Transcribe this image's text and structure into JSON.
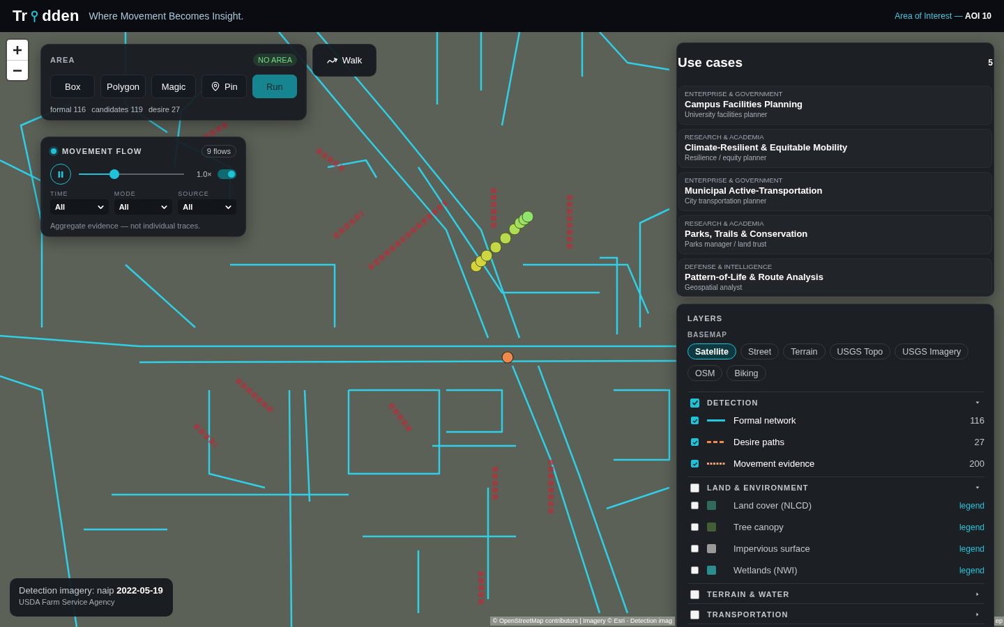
{
  "header": {
    "logo_left": "Tr",
    "logo_right": "dden",
    "tagline": "Where Movement Becomes Insight.",
    "area_of_interest": "Area of Interest — **AOI 10**"
  },
  "area_panel": {
    "title": "AREA",
    "status": "NO AREA",
    "tools": [
      {
        "label": "Box",
        "kind": "mode"
      },
      {
        "label": "Polygon",
        "kind": "mode"
      },
      {
        "label": "Magic",
        "kind": "mode"
      },
      {
        "label": "Pin",
        "kind": "pin"
      },
      {
        "label": "Run",
        "kind": "run"
      }
    ],
    "stats": [
      "formal 116",
      "candidates 119",
      "desire 27"
    ]
  },
  "walk_button": {
    "label": "Walk"
  },
  "flow_panel": {
    "title": "MOVEMENT FLOW",
    "count": "9 flows",
    "playing": true,
    "timeline": {
      "level": 0.32
    },
    "speed": "1.0×",
    "toggle": {
      "on": true
    },
    "filters": [
      {
        "label": "TIME",
        "value": "All"
      },
      {
        "label": "MODE",
        "value": "All"
      },
      {
        "label": "SOURCE",
        "value": "All"
      }
    ],
    "note": "Aggregate evidence — not individual traces."
  },
  "use_cases": {
    "title": "Use cases",
    "count": "5",
    "items": [
      {
        "category": "ENTERPRISE & GOVERNMENT",
        "title": "Campus Facilities Planning",
        "role": "University facilities planner"
      },
      {
        "category": "RESEARCH & ACADEMIA",
        "title": "Climate-Resilient & Equitable Mobility",
        "role": "Resilience / equity planner"
      },
      {
        "category": "ENTERPRISE & GOVERNMENT",
        "title": "Municipal Active-Transportation",
        "role": "City transportation planner"
      },
      {
        "category": "RESEARCH & ACADEMIA",
        "title": "Parks, Trails & Conservation",
        "role": "Parks manager / land trust"
      },
      {
        "category": "DEFENSE & INTELLIGENCE",
        "title": "Pattern-of-Life & Route Analysis",
        "role": "Geospatial analyst"
      }
    ]
  },
  "layers": {
    "title": "LAYERS",
    "basemap_label": "BASEMAP",
    "basemaps": [
      {
        "label": "Satellite",
        "selected": true
      },
      {
        "label": "Street",
        "selected": false
      },
      {
        "label": "Terrain",
        "selected": false
      },
      {
        "label": "USGS Topo",
        "selected": false
      },
      {
        "label": "USGS Imagery",
        "selected": false
      },
      {
        "label": "OSM",
        "selected": false
      },
      {
        "label": "Biking",
        "selected": false
      }
    ],
    "groups": [
      {
        "label": "DETECTION",
        "checked": true,
        "expanded": true,
        "items": [
          {
            "label": "Formal network",
            "checked": true,
            "kind": "line",
            "color": "#22c8e0",
            "count": "116"
          },
          {
            "label": "Desire paths",
            "checked": true,
            "kind": "dashed",
            "color": "#f5894a",
            "count": "27"
          },
          {
            "label": "Movement evidence",
            "checked": true,
            "kind": "dotted",
            "color": "#f0a070",
            "count": "200"
          }
        ]
      },
      {
        "label": "LAND & ENVIRONMENT",
        "checked": false,
        "expanded": true,
        "items": [
          {
            "label": "Land cover (NLCD)",
            "checked": false,
            "kind": "fill",
            "color": "#2f6a5a",
            "link": "legend"
          },
          {
            "label": "Tree canopy",
            "checked": false,
            "kind": "fill",
            "color": "#415e36",
            "link": "legend"
          },
          {
            "label": "Impervious surface",
            "checked": false,
            "kind": "fill",
            "color": "#9a9a9a",
            "link": "legend"
          },
          {
            "label": "Wetlands (NWI)",
            "checked": false,
            "kind": "fill",
            "color": "#2b8d8e",
            "link": "legend"
          }
        ]
      },
      {
        "label": "TERRAIN & WATER",
        "checked": false,
        "expanded": false
      },
      {
        "label": "TRANSPORTATION",
        "checked": false,
        "expanded": false
      }
    ]
  },
  "imagery_note": {
    "text": "Detection imagery: naip **2022-05-19**",
    "source": "USDA Farm Service Agency"
  },
  "attribution": {
    "text": "© OpenStreetMap contributors | Imagery © Esri · Detection imag",
    "tail": "ep"
  }
}
